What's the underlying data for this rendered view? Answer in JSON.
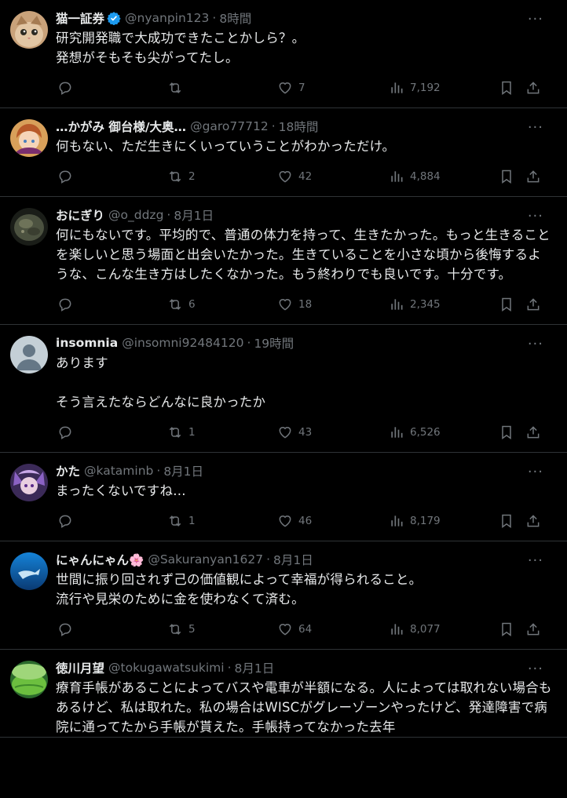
{
  "tweets": [
    {
      "name": "猫一証券",
      "verified": true,
      "handle": "@nyanpin123",
      "time": "8時間",
      "text": "研究開発職で大成功できたことかしら？。\n発想がそもそも尖がってたし。",
      "replies": "",
      "retweets": "",
      "likes": "7",
      "views": "7,192",
      "avatar": "cat-avatar"
    },
    {
      "name": "…かがみ 御台様/大奥…",
      "verified": false,
      "handle": "@garo77712",
      "time": "18時間",
      "text": "何もない、ただ生きにくいっていうことがわかっただけ。",
      "replies": "",
      "retweets": "2",
      "likes": "42",
      "views": "4,884",
      "avatar": "anime-avatar"
    },
    {
      "name": "おにぎり",
      "verified": false,
      "handle": "@o_ddzg",
      "time": "8月1日",
      "text": "何にもないです。平均的で、普通の体力を持って、生きたかった。もっと生きることを楽しいと思う場面と出会いたかった。生きていることを小さな頃から後悔するような、こんな生き方はしたくなかった。もう終わりでも良いです。十分です。",
      "replies": "",
      "retweets": "6",
      "likes": "18",
      "views": "2,345",
      "avatar": "rock-avatar"
    },
    {
      "name": "insomnia",
      "verified": false,
      "handle": "@insomni92484120",
      "time": "19時間",
      "text": "あります\n\nそう言えたならどんなに良かったか",
      "replies": "",
      "retweets": "1",
      "likes": "43",
      "views": "6,526",
      "avatar": "default-avatar"
    },
    {
      "name": "かた",
      "verified": false,
      "handle": "@kataminb",
      "time": "8月1日",
      "text": "まったくないですね…",
      "replies": "",
      "retweets": "1",
      "likes": "46",
      "views": "8,179",
      "avatar": "purple-avatar"
    },
    {
      "name": "にゃんにゃん🌸",
      "verified": false,
      "handle": "@Sakuranyan1627",
      "time": "8月1日",
      "text": "世間に振り回されず己の価値観によって幸福が得られること。\n流行や見栄のために金を使わなくて済む。",
      "replies": "",
      "retweets": "5",
      "likes": "64",
      "views": "8,077",
      "avatar": "ocean-avatar"
    },
    {
      "name": "徳川月望",
      "verified": false,
      "handle": "@tokugawatsukimi",
      "time": "8月1日",
      "text": "療育手帳があることによってバスや電車が半額になる。人によっては取れない場合もあるけど、私は取れた。私の場合はWISCがグレーゾーンやったけど、発達障害で病院に通ってたから手帳が貰えた。手帳持ってなかった去年",
      "replies": "",
      "retweets": "",
      "likes": "",
      "views": "",
      "avatar": "green-avatar"
    }
  ],
  "ui": {
    "dot": "·",
    "more": "···"
  },
  "colors": {
    "background": "#000000",
    "text": "#e7e9ea",
    "muted": "#71767b",
    "divider": "#2f3336",
    "verified": "#1d9bf0"
  }
}
